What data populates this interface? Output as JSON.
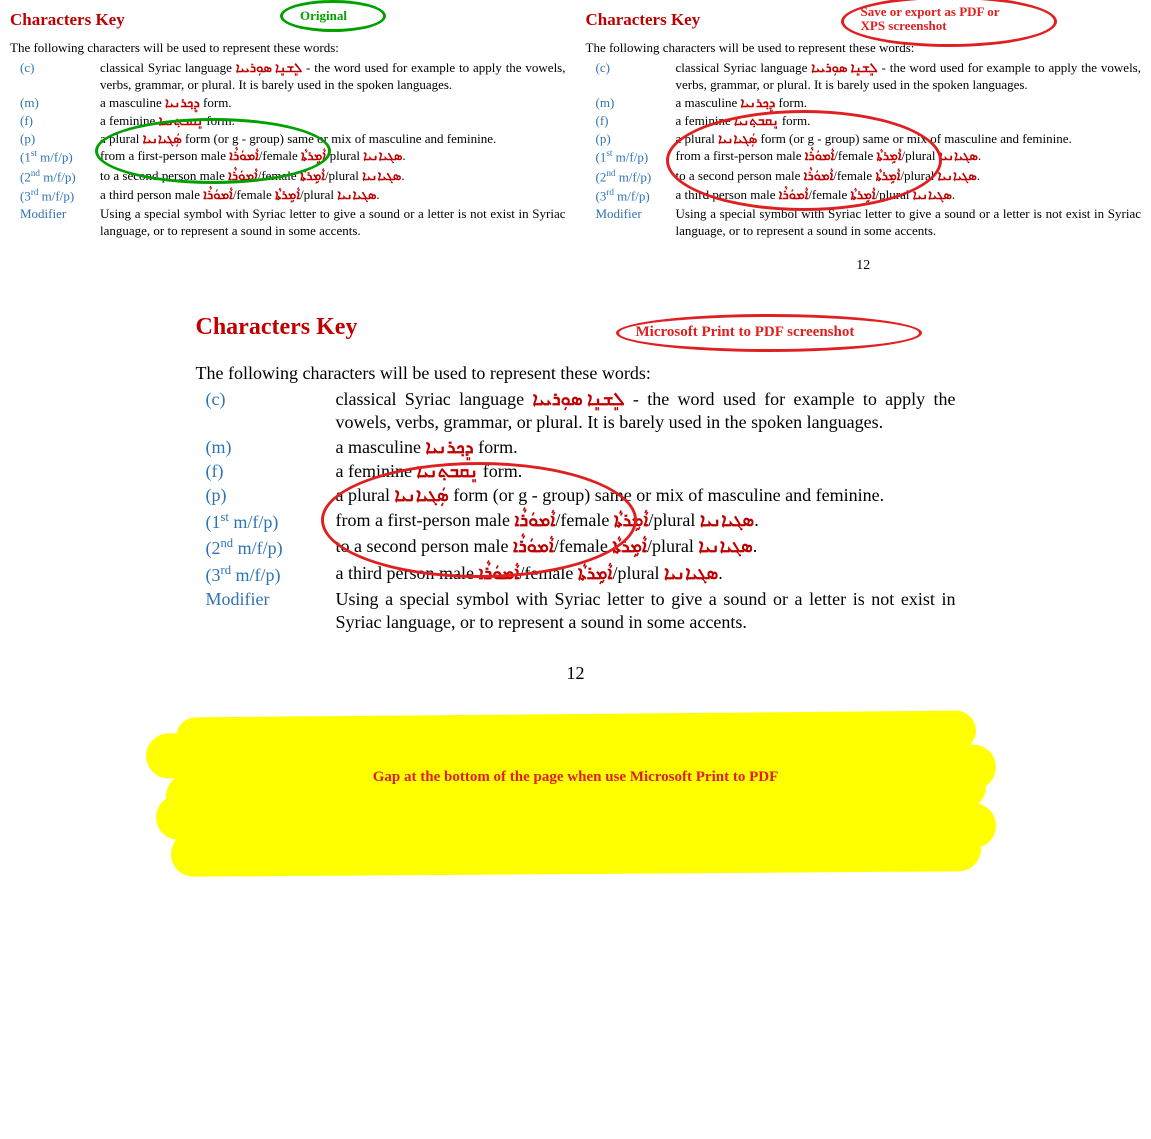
{
  "labels": {
    "original": "Original",
    "saveExport": "Save or export as PDF or\nXPS screenshot",
    "msPrint": "Microsoft Print to PDF screenshot",
    "gapCaption": "Gap at the bottom of the page when use Microsoft Print to PDF"
  },
  "heading": "Characters Key",
  "intro": "The following characters will be used to represent these words:",
  "pageNumber": "12",
  "rows": {
    "c": {
      "key": "(c)",
      "pre": "classical Syriac language ",
      "sy": "ܠܸܫܢܸܐ ܣܘܼܪܝܝܐ",
      "post": " - the word used for example to apply the vowels, verbs, grammar, or plural. It is barely used in the spoken languages."
    },
    "m": {
      "key": "(m)",
      "pre": "a masculine ",
      "sy": "ܕܸܟ݂ܪܢܝܐ",
      "post": " form."
    },
    "f": {
      "key": "(f)",
      "pre": "a feminine ",
      "sy": "ܢܸܩܒܬ݂ܢܝܐ",
      "post": " form."
    },
    "p": {
      "key": "(p)",
      "pre": "a plural ",
      "sy": "ܣܲܓܝܐܢܝܐ",
      "post": " form (or g - group) same or mix of masculine and feminine."
    },
    "p1": {
      "key_html": "(1<sup>st</sup> m/f/p)",
      "t1": "from a first-person male ",
      "s1": "ܐܵܡܘܿܪܵܐ",
      "t2": "/female ",
      "s2": "ܐܵܡܹܪܬܵܐ",
      "t3": "/plural ",
      "s3": "ܣܓܝܐܢܝܐ",
      "t4": "."
    },
    "p2": {
      "key_html": "(2<sup>nd</sup> m/f/p)",
      "t1": "to a second person male ",
      "s1": "ܐܵܡܘܿܪܵܐ",
      "t2": "/female ",
      "s2": "ܐܵܡܹܪܬܵܐ",
      "t3": "/plural ",
      "s3": "ܣܓܝܐܢܝܐ",
      "t4": "."
    },
    "p3": {
      "key_html": "(3<sup>rd</sup> m/f/p)",
      "t1": "a third person male ",
      "s1": "ܐܵܡܘܿܪܵܐ",
      "t2": "/female ",
      "s2": "ܐܵܡܹܪܬܵܐ",
      "t3": "/plural ",
      "s3": "ܣܓܝܐܢܝܐ",
      "t4": "."
    },
    "mod": {
      "key": "Modifier",
      "text": "Using a special symbol with Syriac letter to give a sound or a letter is not exist in Syriac language, or to represent a sound in some accents."
    }
  }
}
